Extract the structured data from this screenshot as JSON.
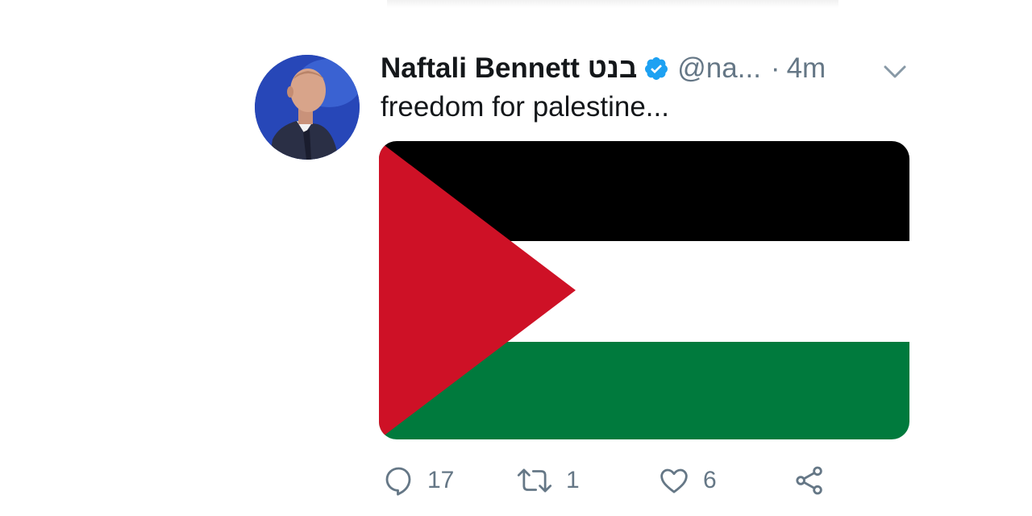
{
  "tweet": {
    "author_name": "Naftali Bennett בנט",
    "handle": "@na...",
    "separator": "·",
    "time": "4m",
    "text": "freedom for palestine...",
    "verified": true,
    "media": {
      "type": "flag",
      "colors": {
        "black": "#000000",
        "white": "#ffffff",
        "green": "#007a3d",
        "red": "#ce1126"
      }
    },
    "actions": {
      "reply_count": "17",
      "retweet_count": "1",
      "like_count": "6"
    }
  },
  "icons": {
    "verified": "verified-badge-icon",
    "caret": "chevron-down-icon",
    "reply": "reply-bubble-icon",
    "retweet": "retweet-icon",
    "like": "heart-icon",
    "share": "share-icon"
  },
  "colors": {
    "verified_blue": "#1da1f2",
    "muted_text": "#657786",
    "primary_text": "#14171a"
  }
}
